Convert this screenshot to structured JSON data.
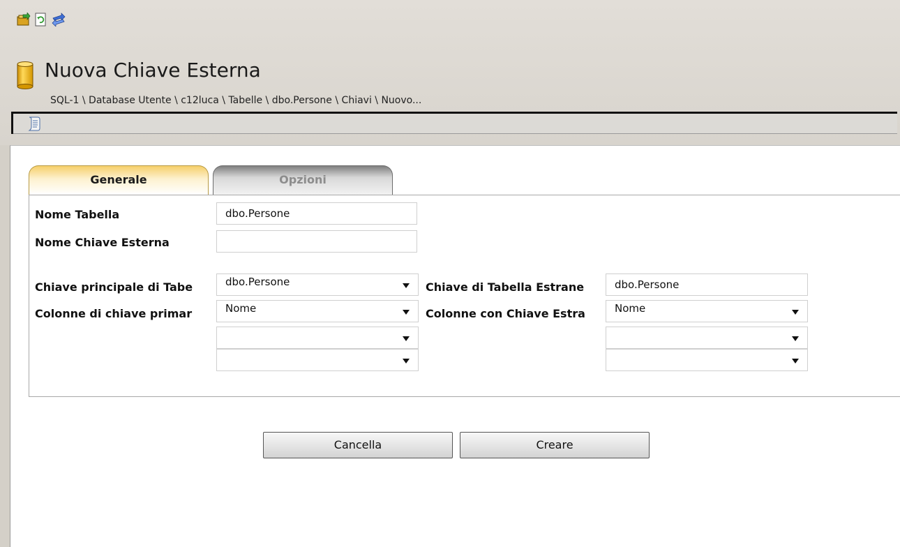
{
  "toolbar": {
    "icons": [
      "export-icon",
      "refresh-icon",
      "sync-icon"
    ]
  },
  "header": {
    "title": "Nuova Chiave Esterna",
    "breadcrumb": "SQL-1 \\ Database Utente \\ c12luca \\ Tabelle \\ dbo.Persone \\ Chiavi \\ Nuovo...",
    "script_icon": "script-icon"
  },
  "tabs": [
    {
      "label": "Generale",
      "active": true
    },
    {
      "label": "Opzioni",
      "active": false
    }
  ],
  "form": {
    "nome_tabella_label": "Nome Tabella",
    "nome_tabella_value": "dbo.Persone",
    "nome_chiave_label": "Nome Chiave Esterna",
    "nome_chiave_value": "",
    "chiave_principale_label": "Chiave principale di Tabe",
    "chiave_principale_value": "dbo.Persone",
    "colonne_primaria_label": "Colonne di chiave primar",
    "colonne_primaria_values": [
      "Nome",
      "",
      ""
    ],
    "chiave_estranea_label": "Chiave di Tabella Estrane",
    "chiave_estranea_value": "dbo.Persone",
    "colonne_estranea_label": "Colonne con Chiave Estra",
    "colonne_estranea_values": [
      "Nome",
      "",
      ""
    ]
  },
  "buttons": {
    "cancel_label": "Cancella",
    "create_label": "Creare"
  },
  "colors": {
    "chrome": "#d4d0c8",
    "active_tab": "#f6cf6a",
    "inactive_tab": "#7f7f7f",
    "db_icon": "#e8a800"
  }
}
